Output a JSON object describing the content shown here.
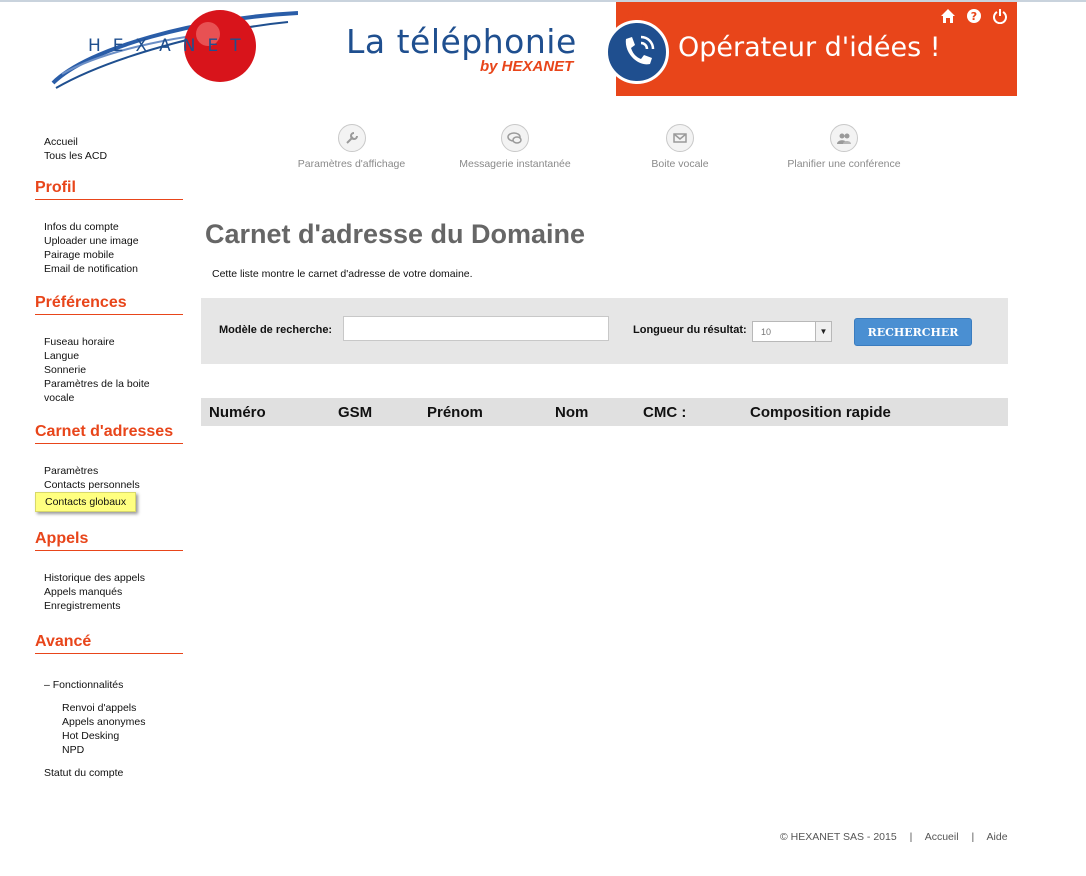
{
  "header": {
    "logo_text": "HEXANET",
    "banner_title": "La téléphonie",
    "banner_sub": "by HEXANET",
    "banner_slogan": "Opérateur d'idées !",
    "icons": [
      "home-icon",
      "help-icon",
      "power-icon"
    ]
  },
  "sidebar": {
    "top_links": [
      "Accueil",
      "Tous les ACD"
    ],
    "sections": {
      "profil": {
        "title": "Profil",
        "items": [
          "Infos du compte",
          "Uploader une image",
          "Pairage mobile",
          "Email de notification"
        ]
      },
      "preferences": {
        "title": "Préférences",
        "items": [
          "Fuseau horaire",
          "Langue",
          "Sonnerie",
          "Paramètres de la boite",
          "vocale"
        ]
      },
      "carnet": {
        "title": "Carnet d'adresses",
        "items": [
          "Paramètres",
          "Contacts personnels",
          "Contacts globaux"
        ]
      },
      "appels": {
        "title": "Appels",
        "items": [
          "Historique des appels",
          "Appels manqués",
          "Enregistrements"
        ]
      },
      "avance": {
        "title": "Avancé",
        "group": "– Fonctionnalités",
        "items": [
          "Renvoi d'appels",
          "Appels anonymes",
          "Hot Desking",
          "NPD"
        ],
        "last": "Statut du compte"
      }
    }
  },
  "toolbar": {
    "items": [
      {
        "label": "Paramètres d'affichage",
        "icon": "wrench-icon"
      },
      {
        "label": "Messagerie instantanée",
        "icon": "chat-icon"
      },
      {
        "label": "Boite vocale",
        "icon": "envelope-icon"
      },
      {
        "label": "Planifier une conférence",
        "icon": "group-icon"
      }
    ]
  },
  "main": {
    "title": "Carnet d'adresse du Domaine",
    "description": "Cette liste montre le carnet d'adresse de votre domaine.",
    "search": {
      "label": "Modèle de recherche:",
      "value": "",
      "length_label": "Longueur du résultat:",
      "length_value": "10",
      "button": "RECHERCHER"
    },
    "table_headers": [
      "Numéro",
      "GSM",
      "Prénom",
      "Nom",
      "CMC :",
      "Composition rapide"
    ]
  },
  "footer": {
    "copyright": "© HEXANET SAS - 2015",
    "separator": "|",
    "link_home": "Accueil",
    "link_help": "Aide"
  },
  "colors": {
    "accent": "#e8451a",
    "brand_blue": "#1f4f8f",
    "button": "#4a8fd2"
  }
}
